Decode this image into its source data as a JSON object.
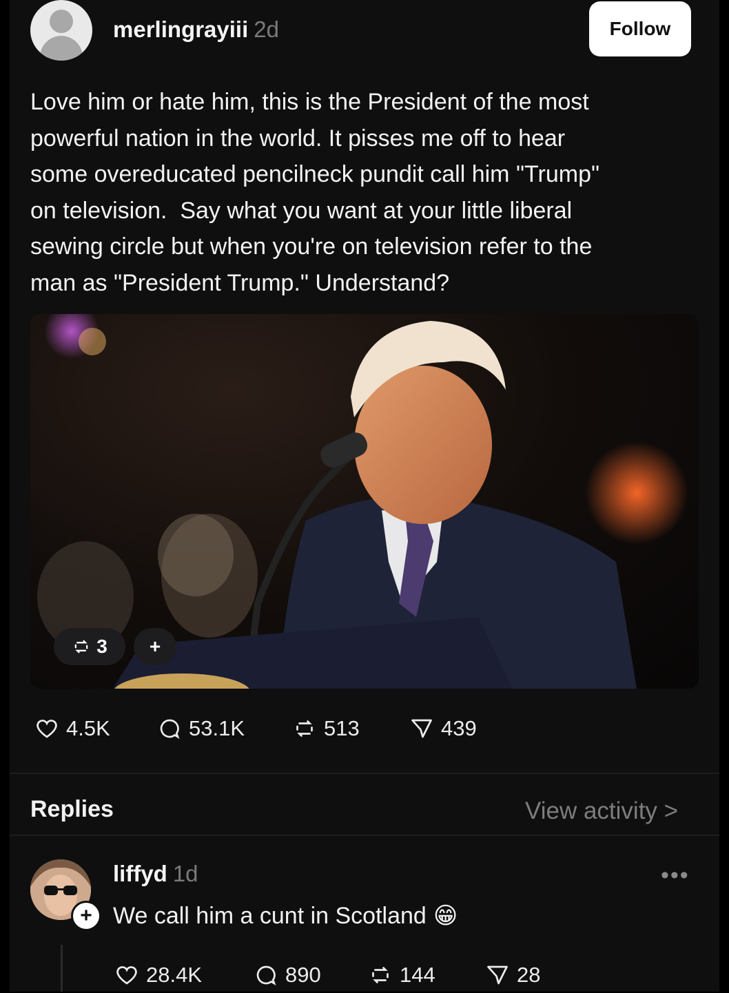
{
  "post": {
    "username": "merlingrayiii",
    "time": "2d",
    "follow_label": "Follow",
    "text": "Love him or hate him, this is the President of the most\npowerful nation in the world. It pisses me off to hear\nsome overeducated pencilneck pundit call him \"Trump\"\non television.  Say what you want at your little liberal\nsewing circle but when you're on television refer to the\nman as \"President Trump.\" Understand?",
    "media": {
      "repost_count": "3",
      "add_label": "+"
    },
    "stats": {
      "likes": "4.5K",
      "comments": "53.1K",
      "reposts": "513",
      "shares": "439"
    }
  },
  "replies_section": {
    "title": "Replies",
    "view_activity": "View activity >"
  },
  "reply": {
    "username": "liffyd",
    "time": "1d",
    "text": "We call him a cunt in Scotland",
    "emoji": "😁",
    "more": "•••",
    "stats": {
      "likes": "28.4K",
      "comments": "890",
      "reposts": "144",
      "shares": "28"
    }
  },
  "icons": [
    "heart-icon",
    "comment-icon",
    "repost-icon",
    "share-icon",
    "more-icon",
    "plus-icon"
  ]
}
